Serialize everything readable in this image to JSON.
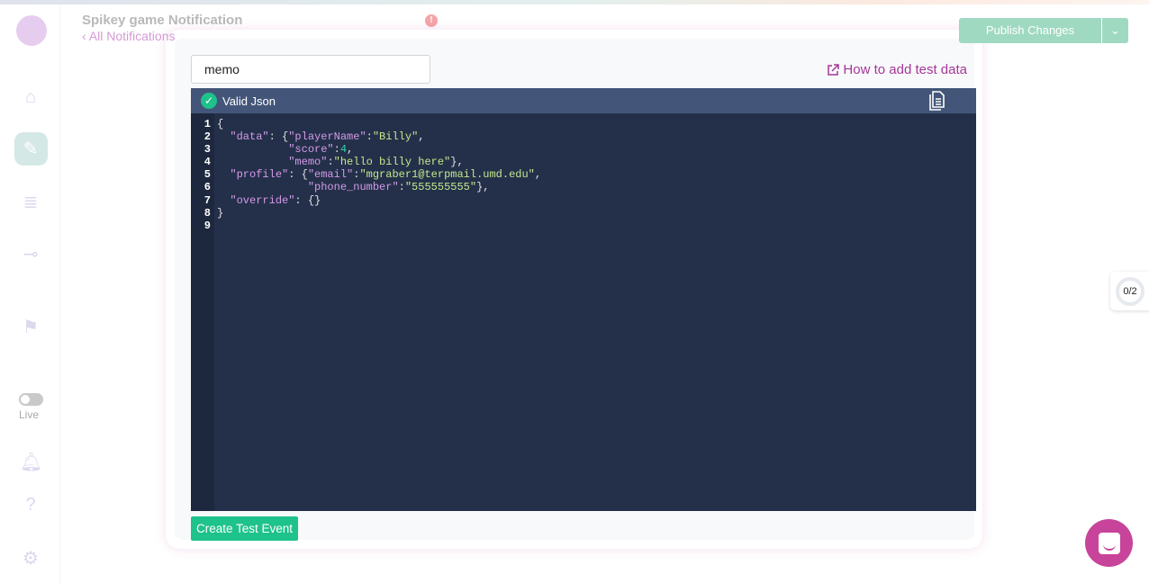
{
  "header": {
    "title": "Spikey game Notification",
    "back_link": "‹ All Notifications",
    "publish_label": "Publish Changes",
    "alert": "!"
  },
  "sidebar": {
    "live_label": "Live"
  },
  "modal": {
    "search_value": "memo",
    "help_link": "How to add test data",
    "status": "Valid Json",
    "line_numbers": [
      "1",
      "2",
      "3",
      "4",
      "5",
      "6",
      "7",
      "8",
      "9"
    ],
    "create_button": "Create Test Event"
  },
  "widgets": {
    "progress": "0/2"
  },
  "colors": {
    "accent": "#1ec28b",
    "brand": "#a63796",
    "editor_bg": "#24304a"
  }
}
